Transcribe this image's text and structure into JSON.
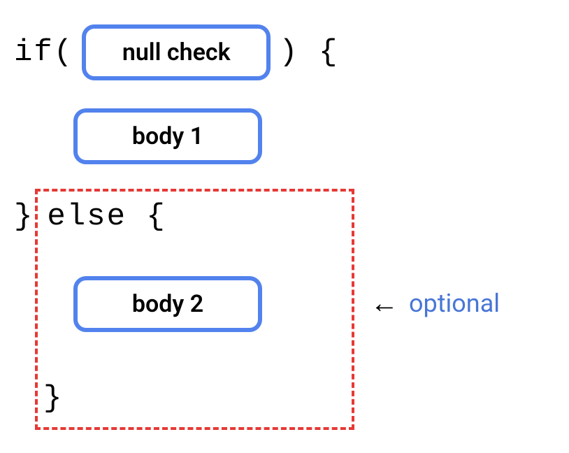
{
  "code": {
    "if_keyword": "if(",
    "close_paren_brace": ") {",
    "close_brace": "}",
    "else_keyword": "else {",
    "final_brace": "}"
  },
  "pills": {
    "null_check": "null check",
    "body1": "body 1",
    "body2": "body 2"
  },
  "annotation": {
    "arrow": "←",
    "label": "optional"
  }
}
